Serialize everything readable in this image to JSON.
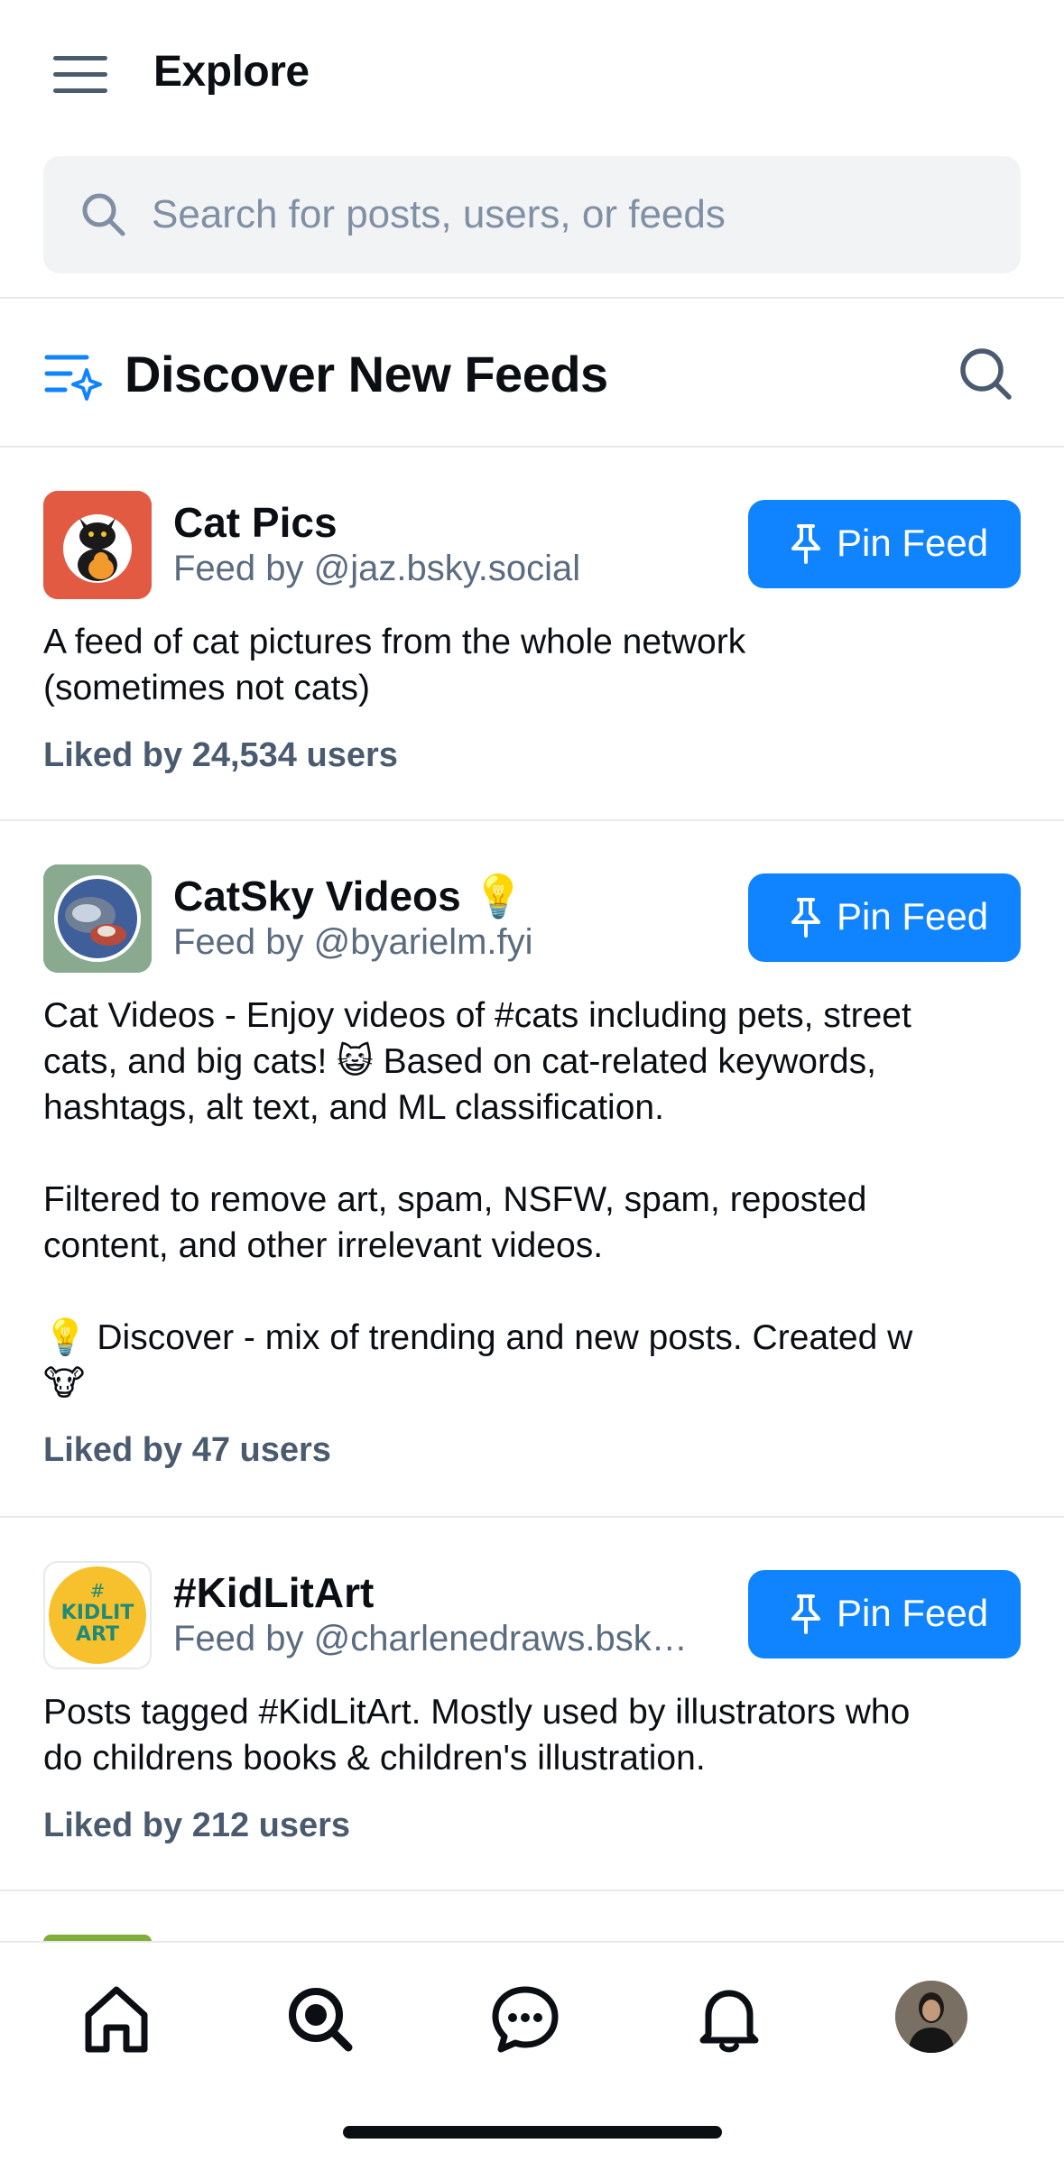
{
  "header": {
    "title": "Explore"
  },
  "search": {
    "placeholder": "Search for posts, users, or feeds"
  },
  "section": {
    "title": "Discover New Feeds"
  },
  "colors": {
    "accent": "#1083fe",
    "muted": "#5b6b80",
    "border": "#e6e9ed"
  },
  "feeds": [
    {
      "name": "Cat Pics",
      "by": "Feed by @jaz.bsky.social",
      "pin_label": "Pin Feed",
      "description": "A feed of cat pictures from the whole network\n(sometimes not cats)",
      "likes": "Liked by 24,534 users"
    },
    {
      "name": "CatSky Videos 💡",
      "by": "Feed by @byarielm.fyi",
      "pin_label": "Pin Feed",
      "description": "Cat Videos - Enjoy videos of #cats including pets, street\ncats, and big cats! 😺 Based on cat-related keywords,\nhashtags, alt text, and ML classification.\n\nFiltered to remove art, spam, NSFW, spam, reposted\ncontent, and other irrelevant videos.\n\n💡 Discover - mix of trending and new posts. Created w\n🐮",
      "likes": "Liked by 47 users"
    },
    {
      "name": "#KidLitArt",
      "by": "Feed by @charlenedraws.bsky...",
      "pin_label": "Pin Feed",
      "description": "Posts tagged #KidLitArt. Mostly used by illustrators who\ndo childrens books & children's illustration.",
      "likes": "Liked by 212 users",
      "avatar_text": "# KIDLIT ART"
    }
  ],
  "tabbar": {
    "tabs": [
      "home-icon",
      "search-icon",
      "chat-icon",
      "bell-icon",
      "profile-avatar"
    ]
  }
}
